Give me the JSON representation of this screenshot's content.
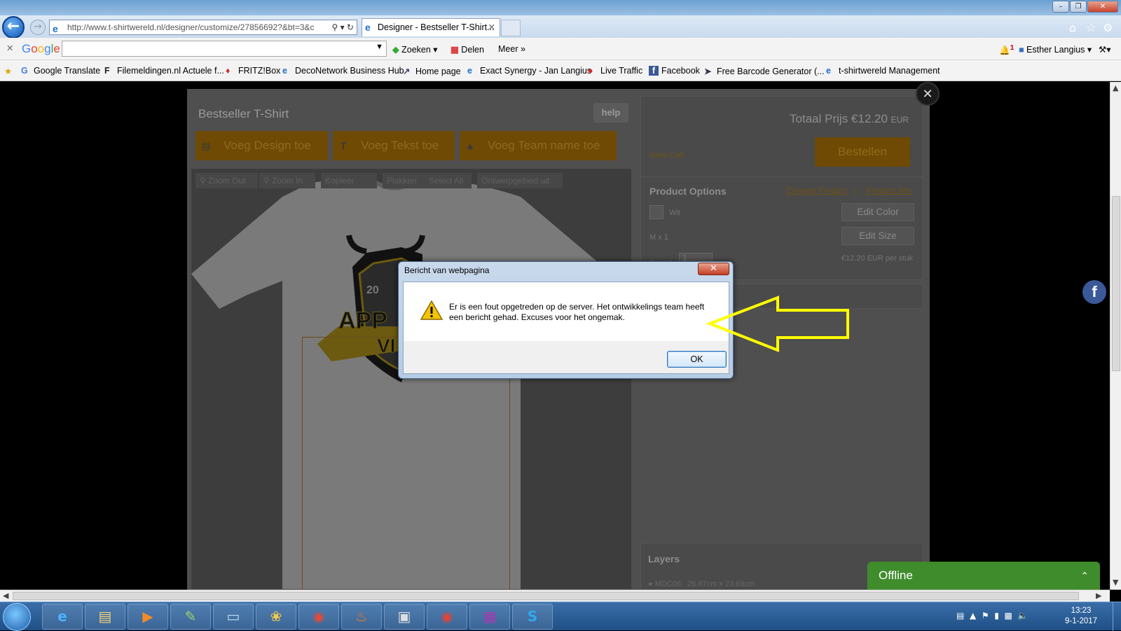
{
  "browser": {
    "address": "http://www.t-shirtwereld.nl/designer/customize/27856692?&bt=3&c",
    "tab_title": "Designer - Bestseller T-Shirt...",
    "window_buttons": [
      "–",
      "❐",
      "✕"
    ]
  },
  "google_bar": {
    "logo": "Google",
    "search_value": "",
    "zoeken": "Zoeken",
    "delen": "Delen",
    "meer": "Meer",
    "user": "Esther Langius",
    "notif_count": "1"
  },
  "favorites": [
    {
      "label": "Google Translate",
      "icon": "translate-icon"
    },
    {
      "label": "Filemeldingen.nl Actuele f...",
      "icon": "f-icon"
    },
    {
      "label": "FRITZ!Box",
      "icon": "fritz-icon"
    },
    {
      "label": "DecoNetwork Business Hub",
      "icon": "ie-page-icon"
    },
    {
      "label": "Home page",
      "icon": "home-page-icon"
    },
    {
      "label": "Exact Synergy - Jan Langius",
      "icon": "ie-page-icon"
    },
    {
      "label": "Live Traffic",
      "icon": "traffic-icon"
    },
    {
      "label": "Facebook",
      "icon": "facebook-icon"
    },
    {
      "label": "Free Barcode Generator (...",
      "icon": "barcode-icon"
    },
    {
      "label": "t-shirtwereld Management",
      "icon": "ie-page-icon"
    }
  ],
  "designer": {
    "title": "Bestseller T-Shirt",
    "help": "help",
    "add_design": "Voeg Design toe",
    "add_text": "Voeg Tekst toe",
    "add_team": "Voeg Team name toe",
    "toolbar": [
      "Zoom Out",
      "Zoom In",
      "Kopieer",
      "Plakken",
      "Select All",
      "Ontwerpgebied uit"
    ],
    "logo_year": "20",
    "logo_text": "APP",
    "logo_text2": "VI"
  },
  "cart": {
    "total_label": "Totaal Prijs €12.20",
    "currency": "EUR",
    "view_cart": "View Cart",
    "order": "Bestellen"
  },
  "product_options": {
    "heading": "Product Options",
    "change_product": "Change Product",
    "separator": "|",
    "product_info": "Product Info",
    "color": "Wit",
    "edit_color": "Edit Color",
    "size": "M x 1",
    "edit_size": "Edit Size",
    "quantity_label": "Aantal",
    "quantity_value": "1",
    "unit_price": "€12.20 EUR per stuk"
  },
  "layers": {
    "heading": "Layers",
    "row_name": "MDC06",
    "row_size": "26.67cm x 23.69cm"
  },
  "chat": {
    "status": "Offline"
  },
  "dialog": {
    "title": "Bericht van webpagina",
    "message": "Er is een fout opgetreden op de server. Het ontwikkelings team heeft een bericht gehad. Excuses voor het ongemak.",
    "ok": "OK"
  },
  "taskbar": {
    "time": "13:23",
    "date": "9-1-2017",
    "apps": [
      "ie-icon",
      "explorer-icon",
      "media-player-icon",
      "notepad-icon",
      "tablet-icon",
      "paint-icon",
      "camera-icon",
      "flame-icon",
      "app-icon",
      "chrome-icon",
      "winrar-icon",
      "skype-icon"
    ]
  },
  "colors": {
    "accent_orange": "#e59600",
    "overlay": "#000000",
    "chat_green": "#3f8c2d",
    "annotation_arrow": "#ffff00"
  }
}
